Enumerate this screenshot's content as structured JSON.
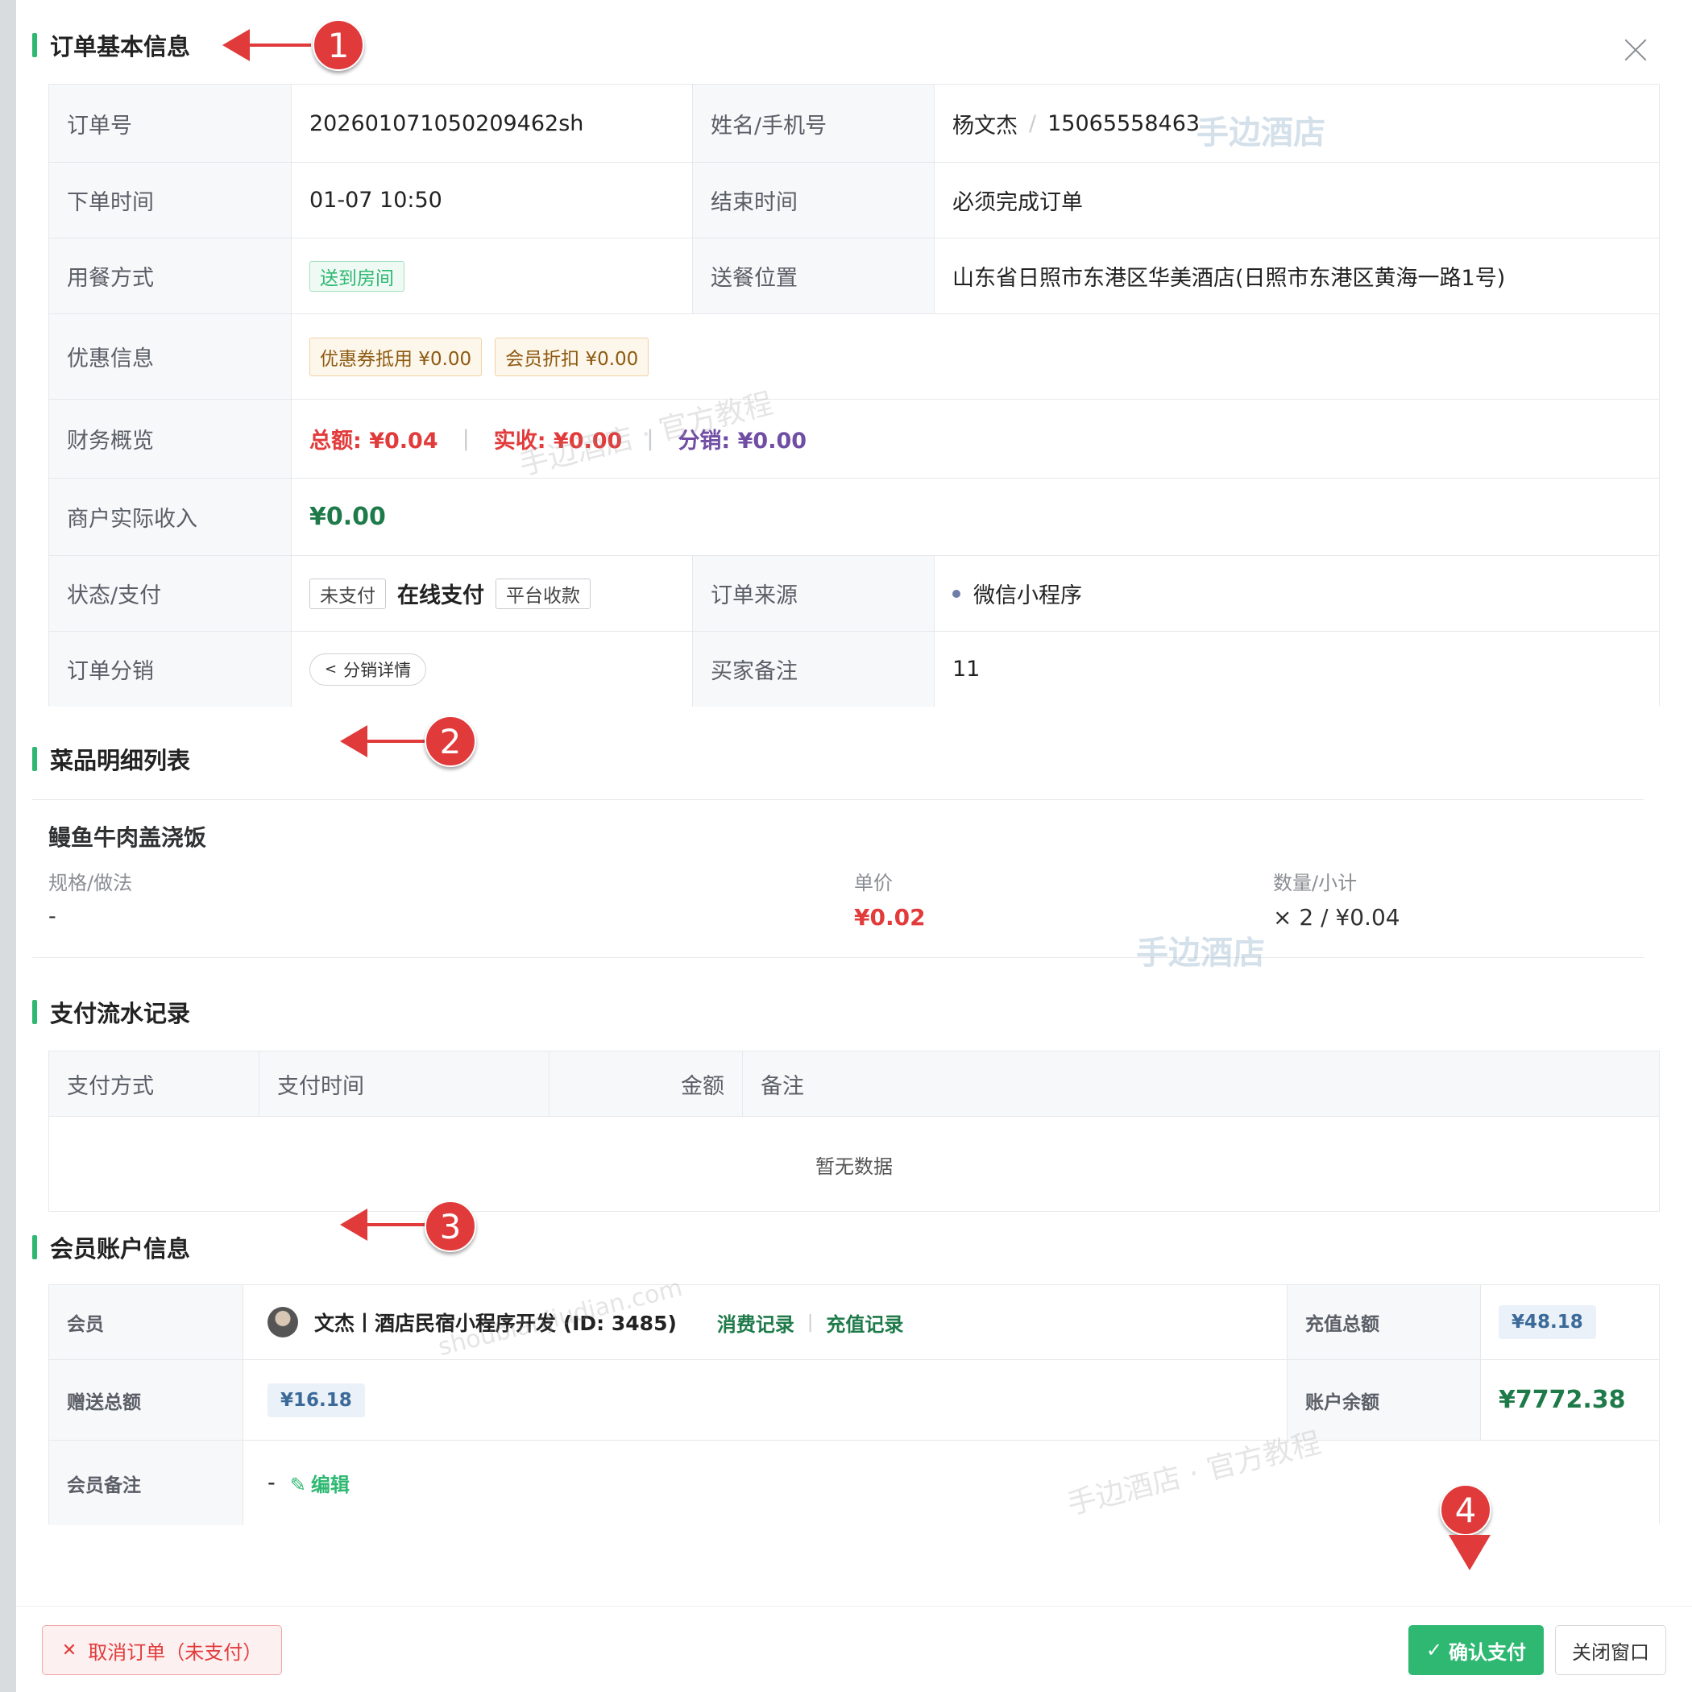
{
  "colors": {
    "accent": "#2eb872",
    "danger": "#e23b3b",
    "purple": "#6f4ea4",
    "annotation": "#e03a3a"
  },
  "dialog": {
    "close_icon": "close-icon"
  },
  "sections": {
    "basic": "订单基本信息",
    "items": "菜品明细列表",
    "payments": "支付流水记录",
    "member": "会员账户信息"
  },
  "order": {
    "order_no_label": "订单号",
    "order_no": "202601071050209462sh",
    "name_phone_label": "姓名/手机号",
    "name": "杨文杰",
    "slash": "/",
    "phone": "15065558463",
    "order_time_label": "下单时间",
    "order_time": "01-07 10:50",
    "end_time_label": "结束时间",
    "end_time": "必须完成订单",
    "dining_label": "用餐方式",
    "dining_tag": "送到房间",
    "location_label": "送餐位置",
    "location": "山东省日照市东港区华美酒店(日照市东港区黄海一路1号)",
    "discount_label": "优惠信息",
    "coupon_tag": "优惠券抵用 ¥0.00",
    "member_discount_tag": "会员折扣 ¥0.00",
    "finance_label": "财务概览",
    "total": "总额: ¥0.04",
    "received": "实收: ¥0.00",
    "distribution": "分销: ¥0.00",
    "sep": "|",
    "income_label": "商户实际收入",
    "income": "¥0.00",
    "status_label": "状态/支付",
    "unpaid_tag": "未支付",
    "pay_method": "在线支付",
    "platform_tag": "平台收款",
    "source_label": "订单来源",
    "source": "微信小程序",
    "dist_label": "订单分销",
    "dist_button": "分销详情",
    "remark_label": "买家备注",
    "remark": "11"
  },
  "dish": {
    "name": "鳗鱼牛肉盖浇饭",
    "spec_label": "规格/做法",
    "spec": "-",
    "price_label": "单价",
    "price": "¥0.02",
    "qty_label": "数量/小计",
    "qty": "× 2 / ¥0.04"
  },
  "payments": {
    "columns": [
      "支付方式",
      "支付时间",
      "金额",
      "备注"
    ],
    "empty": "暂无数据"
  },
  "member": {
    "member_label": "会员",
    "member_name": "文杰丨酒店民宿小程序开发 (ID: 3485)",
    "consume_link": "消费记录",
    "recharge_link": "充值记录",
    "link_sep": "|",
    "recharge_total_label": "充值总额",
    "recharge_total": "¥48.18",
    "gift_total_label": "赠送总额",
    "gift_total": "¥16.18",
    "balance_label": "账户余额",
    "balance": "¥7772.38",
    "note_label": "会员备注",
    "note": "-",
    "edit_link": "编辑"
  },
  "footer": {
    "cancel_button": "取消订单（未支付）",
    "confirm_button": "确认支付",
    "close_button": "关闭窗口"
  },
  "annotations": [
    "1",
    "2",
    "3",
    "4"
  ],
  "watermarks": {
    "brand": "手边酒店",
    "tutorial": "手边酒店 · 官方教程",
    "tutorial_fragment": "手边酒店 · 官方教程",
    "domain": "shoubianjiudian.com"
  }
}
